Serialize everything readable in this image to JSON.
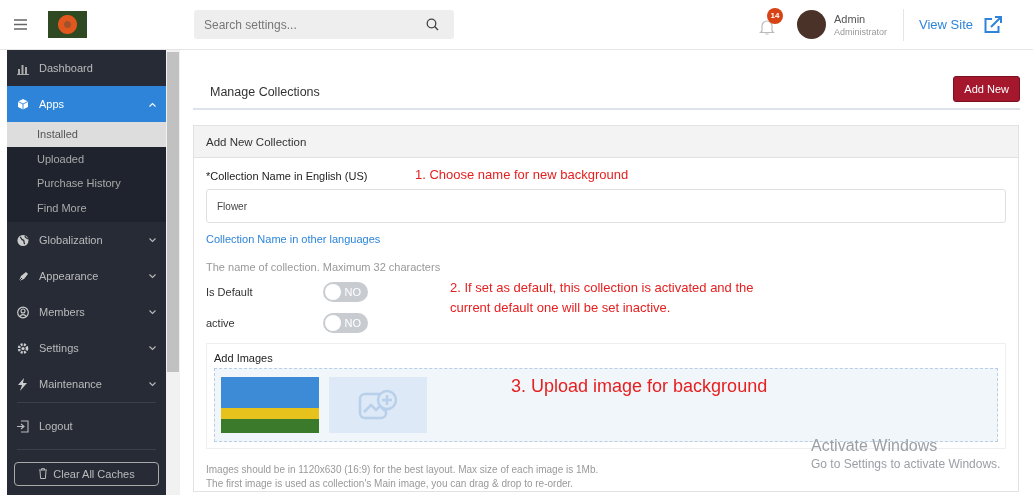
{
  "header": {
    "search": {
      "placeholder": "Search settings..."
    },
    "notifications": {
      "count": "14"
    },
    "user": {
      "name": "Admin",
      "role": "Administrator"
    },
    "view_site": "View Site"
  },
  "sidebar": {
    "items": [
      {
        "label": "Dashboard",
        "selected": false
      },
      {
        "label": "Apps",
        "selected": true,
        "expanded": true,
        "children": [
          {
            "label": "Installed",
            "selected": true
          },
          {
            "label": "Uploaded",
            "selected": false
          },
          {
            "label": "Purchase History",
            "selected": false
          },
          {
            "label": "Find More",
            "selected": false
          }
        ]
      },
      {
        "label": "Globalization",
        "selected": false,
        "expanded": false
      },
      {
        "label": "Appearance",
        "selected": false,
        "expanded": false
      },
      {
        "label": "Members",
        "selected": false,
        "expanded": false
      },
      {
        "label": "Settings",
        "selected": false,
        "expanded": false
      },
      {
        "label": "Maintenance",
        "selected": false,
        "expanded": false
      }
    ],
    "logout": "Logout",
    "clear_caches": "Clear All Caches"
  },
  "page": {
    "title": "Manage Collections",
    "add_new": "Add New",
    "form": {
      "title": "Add New Collection",
      "name_label": "*Collection Name in English (US)",
      "name_value": "Flower",
      "other_languages_link": "Collection Name in other languages",
      "name_help": "The name of collection. Maximum 32 characters",
      "toggles": [
        {
          "label": "Is Default",
          "on": false,
          "text": "NO"
        },
        {
          "label": "active",
          "on": false,
          "text": "NO"
        }
      ],
      "images_label": "Add Images",
      "help_lines": [
        "Images should be in 1120x630 (16:9) for the best layout. Max size of each image is 1Mb.",
        "The first image is used as collection's Main image, you can drag & drop to re-order."
      ]
    }
  },
  "annotations": [
    "1. Choose name for new background",
    "2. If set as default, this collection is activated and the current default one will be set inactive.",
    "3. Upload image for background"
  ],
  "os_overlay": {
    "title": "Activate Windows",
    "subtitle": "Go to Settings to activate Windows."
  }
}
